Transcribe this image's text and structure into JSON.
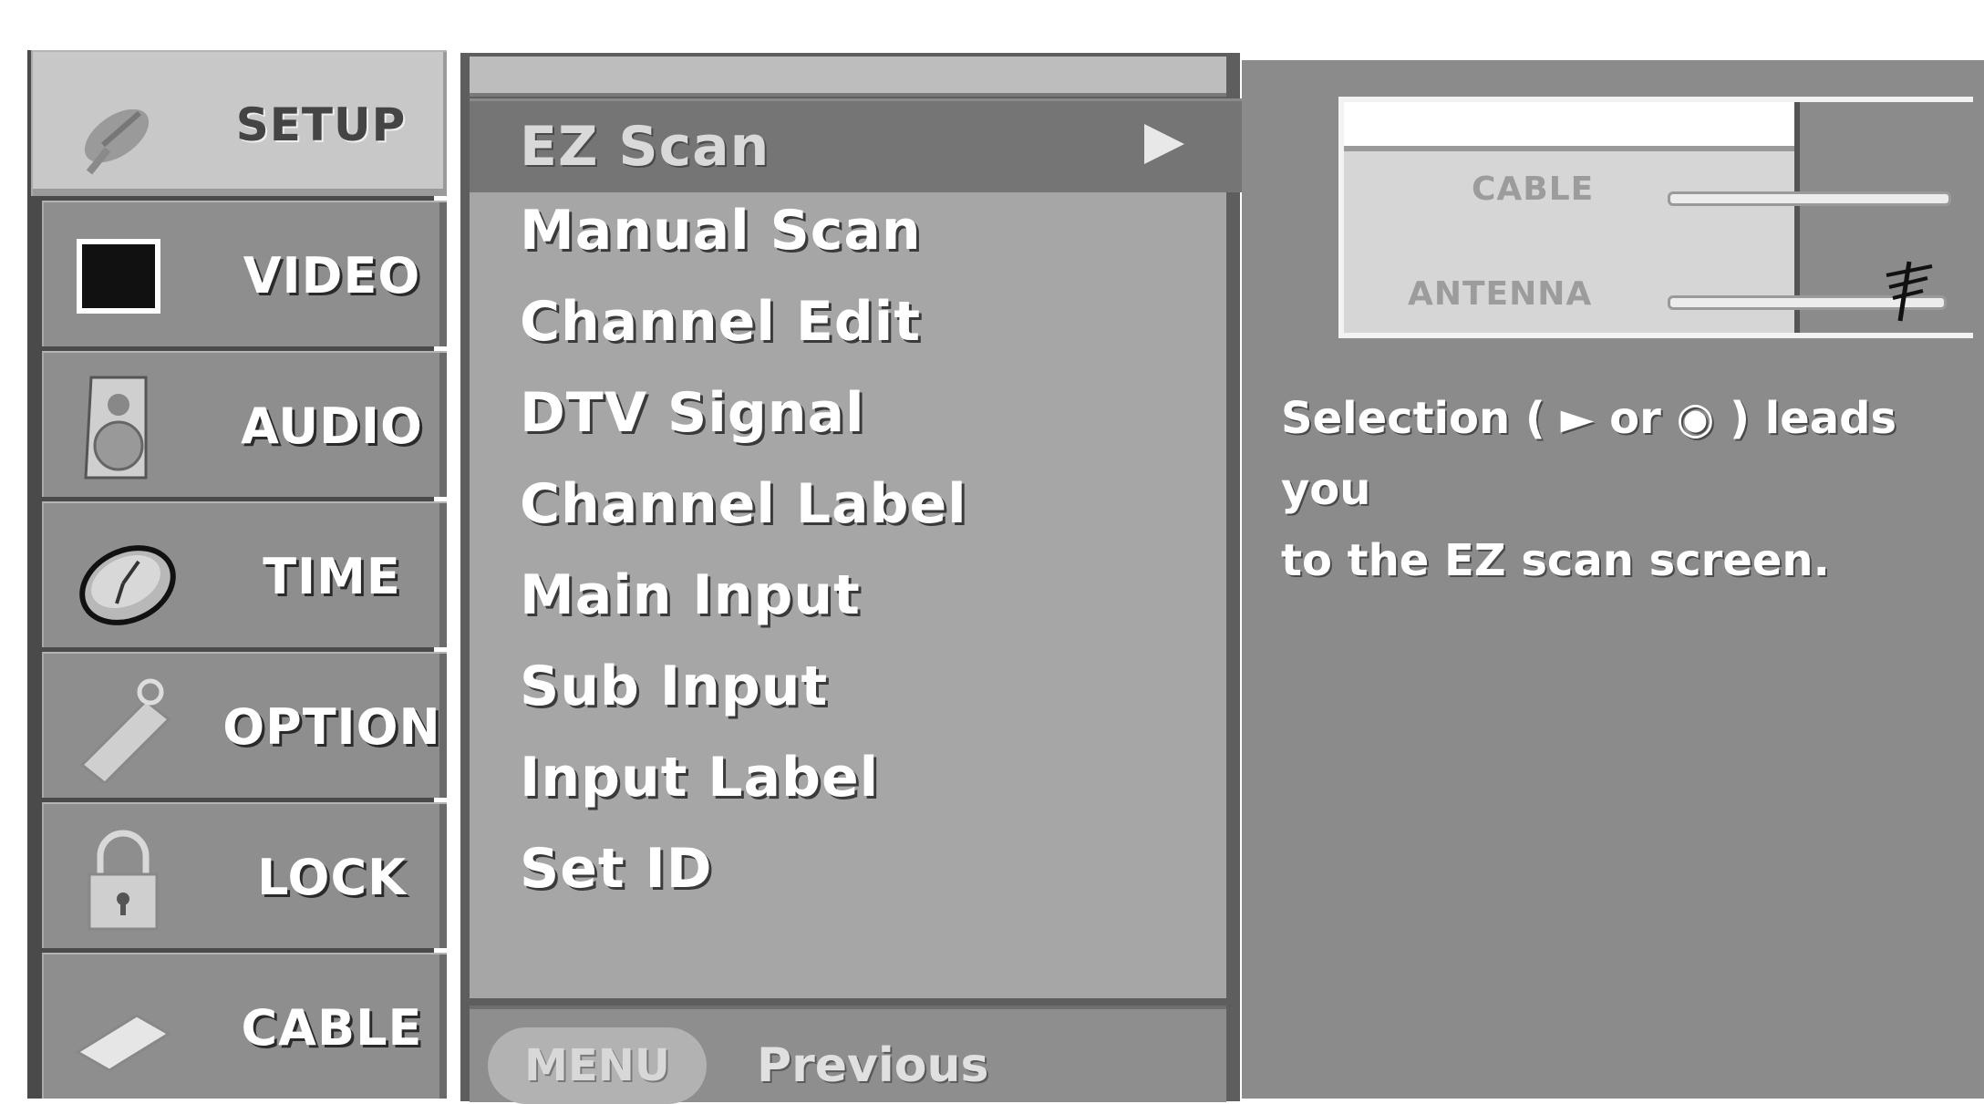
{
  "categories": [
    {
      "label": "SETUP",
      "icon": "satellite-dish-icon",
      "active": true
    },
    {
      "label": "VIDEO",
      "icon": "screen-icon",
      "active": false
    },
    {
      "label": "AUDIO",
      "icon": "speaker-icon",
      "active": false
    },
    {
      "label": "TIME",
      "icon": "clock-icon",
      "active": false
    },
    {
      "label": "OPTION",
      "icon": "tag-icon",
      "active": false
    },
    {
      "label": "LOCK",
      "icon": "padlock-icon",
      "active": false
    },
    {
      "label": "CABLE",
      "icon": "cable-card-icon",
      "active": false
    }
  ],
  "menu": {
    "selected": "EZ Scan",
    "items": [
      "EZ Scan",
      "Manual Scan",
      "Channel Edit",
      "DTV Signal",
      "Channel Label",
      "Main Input",
      "Sub Input",
      "Input Label",
      "Set ID"
    ]
  },
  "footer": {
    "menu_button": "MENU",
    "previous_label": "Previous"
  },
  "info": {
    "cable_label": "CABLE",
    "antenna_label": "ANTENNA",
    "description_line1": "Selection ( ► or ◉ ) leads you",
    "description_line2": "to the EZ scan screen."
  }
}
